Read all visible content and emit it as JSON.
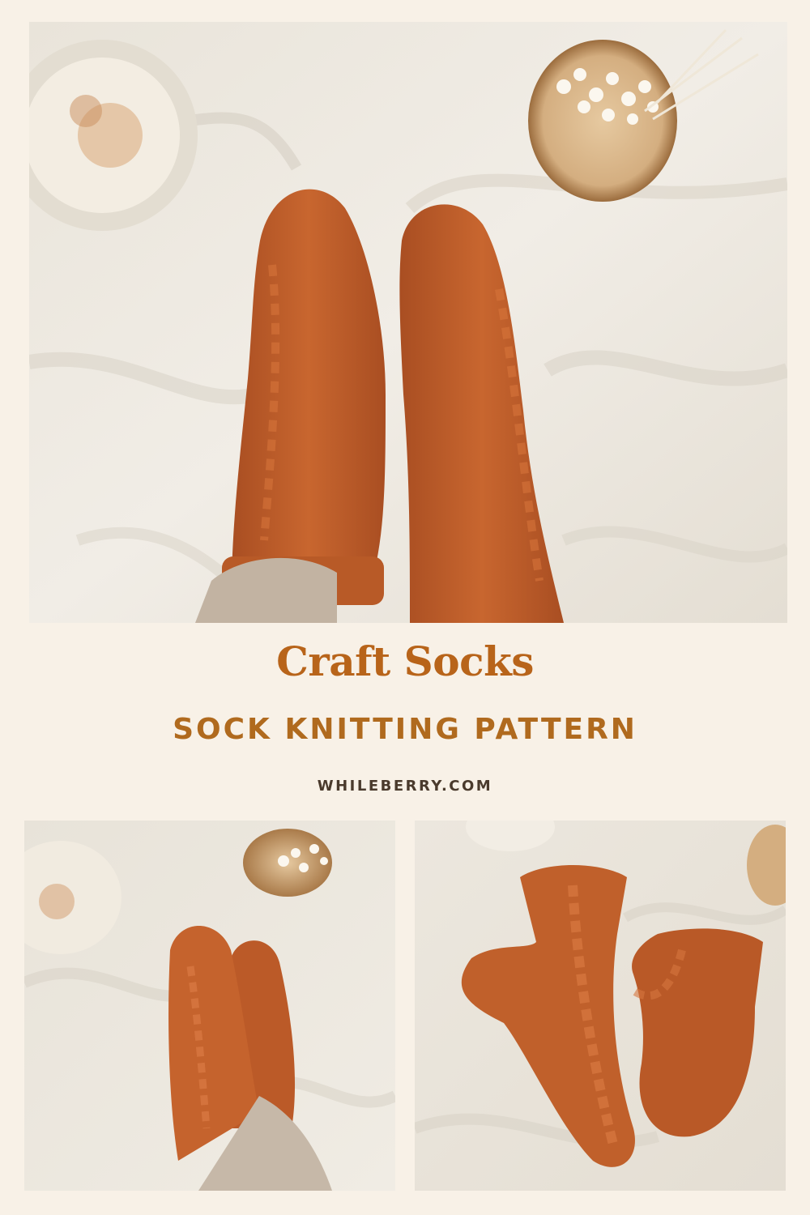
{
  "pin": {
    "title": "Craft Socks",
    "subtitle": "SOCK KNITTING PATTERN",
    "website": "WHILEBERRY.COM"
  },
  "colors": {
    "background": "#f8f1e7",
    "title_text": "#b8641a",
    "subtitle_text": "#b06a1e",
    "website_text": "#4a3a2c",
    "sock_orange": "#c05f2c",
    "blanket_cream": "#ebe6dd",
    "wood_slice": "#d9b488"
  },
  "photos": {
    "top": {
      "subject": "orange cable-knit socks worn on feet on cream blanket"
    },
    "bottom_left": {
      "subject": "side view of worn orange cable socks"
    },
    "bottom_right": {
      "subject": "pair of orange cable socks laid flat"
    }
  }
}
